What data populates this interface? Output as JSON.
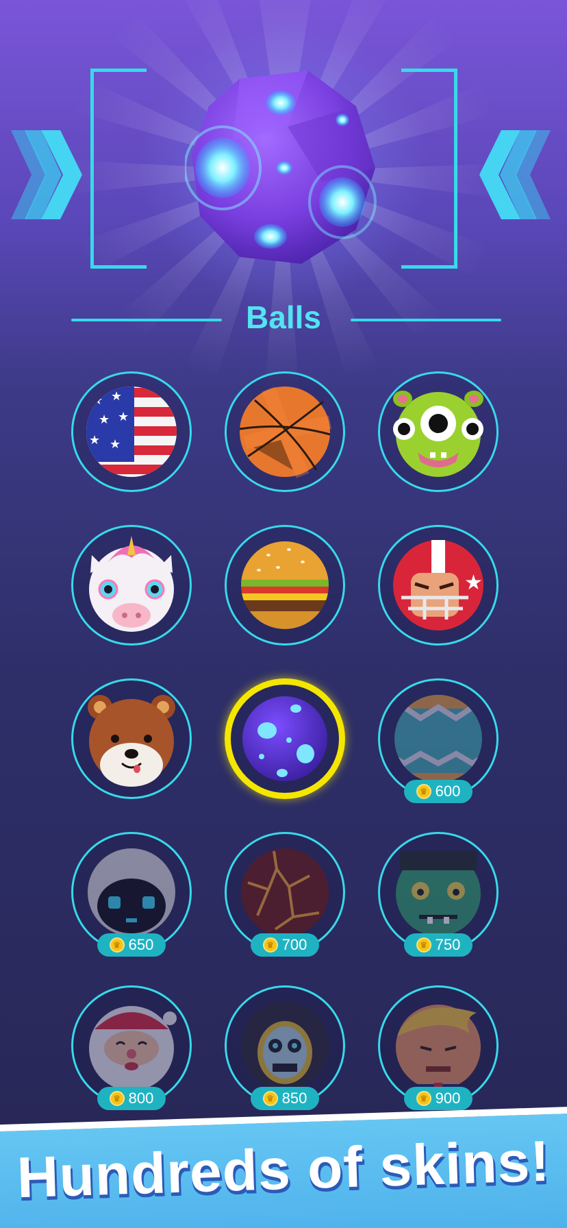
{
  "section_title": "Balls",
  "banner_text": "Hundreds of skins!",
  "colors": {
    "accent": "#38d9ea",
    "selected": "#f5e600",
    "price_pill": "#1fb3c2",
    "banner": "#4aaee9"
  },
  "skins": [
    {
      "name": "usa-flag-ball",
      "price": null
    },
    {
      "name": "basketball",
      "price": null
    },
    {
      "name": "green-monster-ball",
      "price": null
    },
    {
      "name": "unicorn-ball",
      "price": null
    },
    {
      "name": "burger-ball",
      "price": null
    },
    {
      "name": "football-helmet-ball",
      "price": null
    },
    {
      "name": "bear-ball",
      "price": null
    },
    {
      "name": "purple-meteor-ball",
      "price": null,
      "selected": true
    },
    {
      "name": "easter-egg-ball",
      "price": "600"
    },
    {
      "name": "hooded-robot-ball",
      "price": "650"
    },
    {
      "name": "lava-ball",
      "price": "700"
    },
    {
      "name": "zombie-ball",
      "price": "750"
    },
    {
      "name": "santa-ball",
      "price": "800"
    },
    {
      "name": "skeleton-ball",
      "price": "850"
    },
    {
      "name": "blond-man-ball",
      "price": "900"
    }
  ]
}
